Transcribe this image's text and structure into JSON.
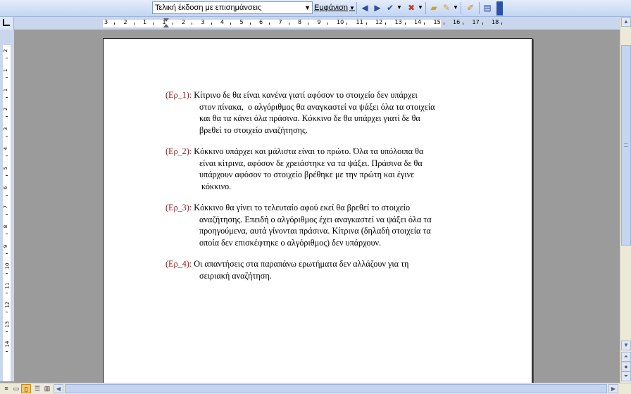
{
  "toolbar": {
    "view_dropdown_value": "Τελική έκδοση με επισημάνσεις",
    "show_label": "Εμφάνιση",
    "icons": [
      "previous-change-icon",
      "next-change-icon",
      "accept-change-icon",
      "reject-change-icon",
      "new-comment-icon",
      "highlight-icon",
      "track-changes-icon",
      "reviewing-pane-icon"
    ]
  },
  "ruler": {
    "h_labels": [
      "3",
      "2",
      "1",
      "1",
      "2",
      "3",
      "4",
      "5",
      "6",
      "7",
      "8",
      "9",
      "10",
      "11",
      "12",
      "13",
      "14",
      "15",
      "16",
      "17",
      "18"
    ],
    "v_labels": [
      "2",
      "1",
      "1",
      "2",
      "3",
      "4",
      "5",
      "6",
      "7",
      "8",
      "9",
      "10",
      "11",
      "12",
      "13",
      "14"
    ]
  },
  "document": {
    "paragraphs": [
      {
        "tag": "(Ερ_1):",
        "lines": [
          "Κίτρινο δε θα είναι κανένα γιατί αφόσον το στοιχείο δεν υπάρχει",
          "στον πίνακα,  ο αλγόριθμος θα αναγκαστεί να ψάξει όλα τα στοιχεία",
          "και θα τα κάνει όλα πράσινα. Κόκκινο δε θα υπάρχει γιατί δε θα",
          "βρεθεί το στοιχείο αναζήτησης."
        ]
      },
      {
        "tag": "(Ερ_2):",
        "lines": [
          "Κόκκινο υπάρχει και μάλιστα είναι το πρώτο. Όλα τα υπόλοιπα θα",
          "είναι κίτρινα, αφόσον δε χρειάστηκε να τα ψάξει. Πράσινα δε θα",
          "υπάρχουν αφόσον το στοιχείο βρέθηκε με την πρώτη και έγινε",
          " κόκκινο."
        ]
      },
      {
        "tag": "(Ερ_3):",
        "lines": [
          "Κόκκινο θα γίνει το τελευταίο αφού εκεί θα βρεθεί το στοιχείο",
          "αναζήτησης. Επειδή ο αλγόριθμος έχει αναγκαστεί να ψάξει όλα τα",
          "προηγούμενα, αυτά γίνονται πράσινα. Κίτρινα (δηλαδή στοιχεία τα",
          "οποία δεν επισκέφτηκε ο αλγόριθμος) δεν υπάρχουν."
        ]
      },
      {
        "tag": "(Ερ_4):",
        "lines": [
          "Οι απαντήσεις στα παραπάνω ερωτήματα δεν αλλάζουν για τη",
          "σειριακή αναζήτηση."
        ]
      }
    ]
  }
}
